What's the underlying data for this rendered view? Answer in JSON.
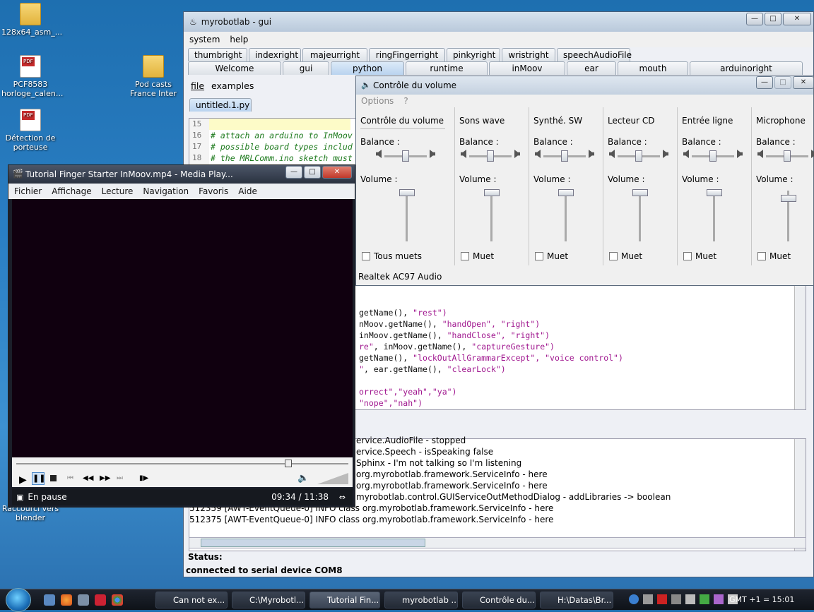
{
  "desktop": {
    "icons": [
      {
        "label": "128x64_asm_...",
        "type": "folder"
      },
      {
        "label": "PCF8583 horloge_calen...",
        "type": "pdf"
      },
      {
        "label": "Détection de porteuse",
        "type": "pdf"
      },
      {
        "label": "Pod casts France Inter",
        "type": "folder"
      },
      {
        "label": "Raccourci vers blender",
        "type": "shortcut"
      }
    ]
  },
  "mrl": {
    "title": "myrobotlab - gui",
    "menu": [
      "system",
      "help"
    ],
    "tabs_row1": [
      "thumbright",
      "indexright",
      "majeurright",
      "ringFingerright",
      "pinkyright",
      "wristright",
      "speechAudioFile"
    ],
    "tabs_row2": [
      "Welcome",
      "gui",
      "python",
      "runtime",
      "inMoov",
      "ear",
      "mouth",
      "arduinoright"
    ],
    "python_menu": [
      "file",
      "examples"
    ],
    "file_tab": "untitled.1.py",
    "gutter": [
      "15",
      "16",
      "17",
      "18"
    ],
    "comments": [
      "# attach an arduino to InMoov",
      "# possible board types includ",
      "# the MRLComm.ino sketch must"
    ],
    "code": [
      [
        "getName(), ",
        "\"rest\")",
        ""
      ],
      [
        "nMoov.getName(), ",
        "\"handOpen\", \"right\")",
        ""
      ],
      [
        "inMoov.getName(), ",
        "\"handClose\", \"right\")",
        ""
      ],
      [
        "re\"",
        ", inMoov.getName(), ",
        "\"captureGesture\")"
      ],
      [
        "getName(), ",
        "\"lockOutAllGrammarExcept\", \"voice control\")",
        ""
      ],
      [
        "\"",
        ", ear.getName(), ",
        "\"clearLock\")"
      ],
      [
        "orrect\",\"yeah\",\"ya\")",
        "",
        ""
      ],
      [
        "\"nope\",\"nah\")",
        "",
        ""
      ]
    ],
    "log": [
      "ervice.AudioFile  - stopped",
      "ervice.Speech  - isSpeaking false",
      "Sphinx  - I'm not talking so I'm listening",
      "org.myrobotlab.framework.ServiceInfo  - here",
      "org.myrobotlab.framework.ServiceInfo  - here",
      "myrobotlab.control.GUIServiceOutMethodDialog  - addLibraries -> boolean",
      "512359 [AWT-EventQueue-0] INFO  class org.myrobotlab.framework.ServiceInfo  - here",
      "512375 [AWT-EventQueue-0] INFO  class org.myrobotlab.framework.ServiceInfo  - here"
    ],
    "status_label": "Status:",
    "status_text": "connected to serial device COM8"
  },
  "volume": {
    "title": "Contrôle du volume",
    "menu": [
      "Options",
      "?"
    ],
    "balance_label": "Balance :",
    "volume_label": "Volume :",
    "channels": [
      {
        "name": "Contrôle du volume",
        "mute": "Tous muets",
        "balance": 0.5,
        "level": 1.0
      },
      {
        "name": "Sons wave",
        "mute": "Muet",
        "balance": 0.5,
        "level": 1.0
      },
      {
        "name": "Synthé. SW",
        "mute": "Muet",
        "balance": 0.5,
        "level": 1.0
      },
      {
        "name": "Lecteur CD",
        "mute": "Muet",
        "balance": 0.5,
        "level": 1.0
      },
      {
        "name": "Entrée ligne",
        "mute": "Muet",
        "balance": 0.5,
        "level": 1.0
      },
      {
        "name": "Microphone",
        "mute": "Muet",
        "balance": 0.5,
        "level": 0.86
      }
    ],
    "device": "Realtek AC97 Audio"
  },
  "player": {
    "title": "Tutorial Finger Starter InMoov.mp4 - Media Play...",
    "menu": [
      "Fichier",
      "Affichage",
      "Lecture",
      "Navigation",
      "Favoris",
      "Aide"
    ],
    "state": "En pause",
    "time": "09:34 / 11:38",
    "seek_fraction": 0.82
  },
  "taskbar": {
    "items": [
      "Can not ex...",
      "C:\\Myrobotl...",
      "Tutorial Fin...",
      "myrobotlab ...",
      "Contrôle du...",
      "H:\\Datas\\Br..."
    ],
    "clock": "GMT +1 = 15:01"
  }
}
